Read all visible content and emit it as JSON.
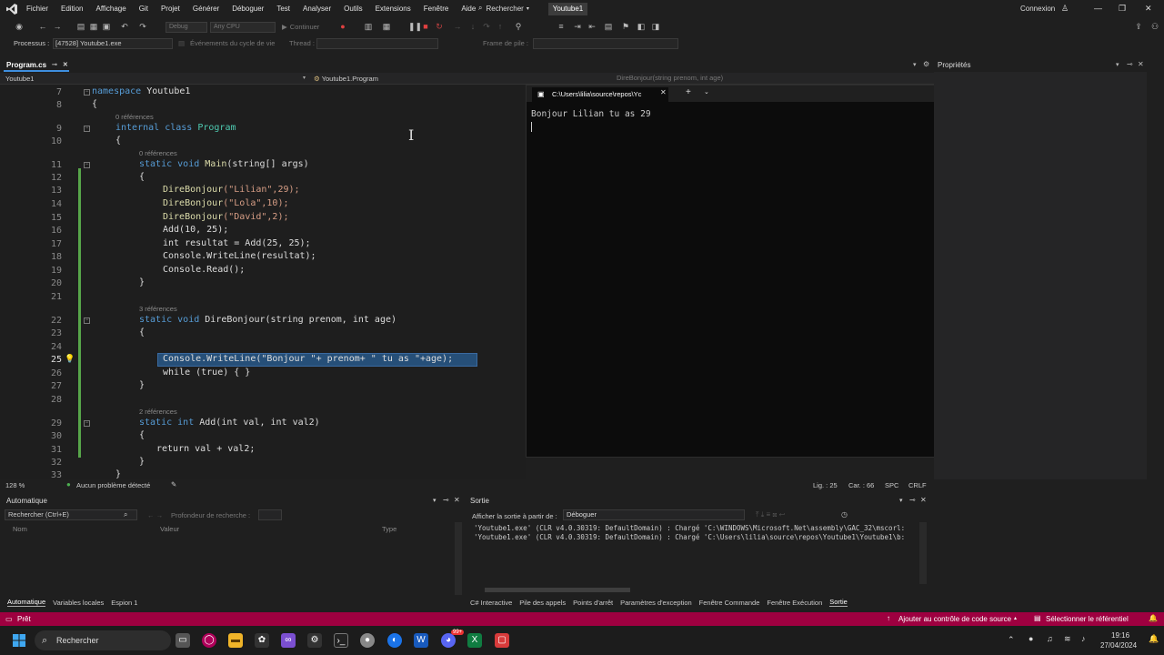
{
  "menubar": {
    "items": [
      "Fichier",
      "Edition",
      "Affichage",
      "Git",
      "Projet",
      "Générer",
      "Déboguer",
      "Test",
      "Analyser",
      "Outils",
      "Extensions",
      "Fenêtre",
      "Aide"
    ],
    "search_label": "Rechercher",
    "solution_name": "Youtube1",
    "connexion_label": "Connexion"
  },
  "toolbar": {
    "config_combo": "Debug",
    "platform_combo": "Any CPU",
    "continue_label": "Continuer"
  },
  "process_bar": {
    "process_label": "Processus :",
    "process_value": "[47528] Youtube1.exe",
    "lifecycle_label": "Événements du cycle de vie",
    "thread_label": "Thread :",
    "frame_label": "Frame de pile :"
  },
  "editor": {
    "tab_label": "Program.cs",
    "nav_project": "Youtube1",
    "nav_class": "Youtube1.Program",
    "nav_member": "DireBonjour(string prenom, int age)",
    "refs": {
      "r0a": "0 références",
      "r0b": "0 références",
      "r3": "3 références",
      "r2": "2 références"
    },
    "line_numbers": {
      "l7": "7",
      "l8": "8",
      "l9": "9",
      "l10": "10",
      "l11": "11",
      "l12": "12",
      "l13": "13",
      "l14": "14",
      "l15": "15",
      "l16": "16",
      "l17": "17",
      "l18": "18",
      "l19": "19",
      "l20": "20",
      "l21": "21",
      "l22": "22",
      "l23": "23",
      "l24": "24",
      "l25": "25",
      "l26": "26",
      "l27": "27",
      "l28": "28",
      "l29": "29",
      "l30": "30",
      "l31": "31",
      "l32": "32",
      "l33": "33"
    },
    "code": {
      "namespace_kw": "namespace",
      "namespace_name": "Youtube1",
      "open_brace": "{",
      "close_brace": "}",
      "internal_kw": "internal",
      "class_kw": "class",
      "class_name": "Program",
      "static_kw": "static",
      "void_kw": "void",
      "int_kw": "int",
      "string_kw": "string",
      "main_name": "Main",
      "main_params": "(string[] args)",
      "call1_fn": "DireBonjour",
      "call1_args": "(\"Lilian\",29);",
      "call2_fn": "DireBonjour",
      "call2_args": "(\"Lola\",10);",
      "call3_fn": "DireBonjour",
      "call3_args": "(\"David\",2);",
      "add_call": "Add(10, 25);",
      "resultat_line": "int resultat = Add(25, 25);",
      "writeline_line": "Console.WriteLine(resultat);",
      "read_line": "Console.Read();",
      "direbonjour_sig": "DireBonjour(string prenom, int age)",
      "selected_line": "Console.WriteLine(\"Bonjour \"+ prenom+ \" tu as \"+age);",
      "while_line": "while (true) { }",
      "add_sig": "Add(int val, int val2)",
      "return_line": "return val + val2;"
    },
    "zoom": "128 %",
    "problems": "Aucun problème détecté",
    "position": "Lig. : 25",
    "column": "Car. : 66",
    "spc": "SPC",
    "crlf": "CRLF"
  },
  "console": {
    "tab_title": "C:\\Users\\lilia\\source\\repos\\Yc",
    "output": "Bonjour Lilian tu as 29"
  },
  "properties": {
    "title": "Propriétés"
  },
  "auto_panel": {
    "title": "Automatique",
    "search_placeholder": "Rechercher (Ctrl+E)",
    "depth_label": "Profondeur de recherche :",
    "col_name": "Nom",
    "col_value": "Valeur",
    "col_type": "Type",
    "tabs": [
      "Automatique",
      "Variables locales",
      "Espion 1"
    ]
  },
  "output_panel": {
    "title": "Sortie",
    "show_from_label": "Afficher la sortie à partir de :",
    "show_from_value": "Déboguer",
    "line1": "'Youtube1.exe' (CLR v4.0.30319: DefaultDomain) : Chargé 'C:\\WINDOWS\\Microsoft.Net\\assembly\\GAC_32\\mscorl:",
    "line2": "'Youtube1.exe' (CLR v4.0.30319: DefaultDomain) : Chargé 'C:\\Users\\lilia\\source\\repos\\Youtube1\\Youtube1\\b:",
    "tabs": [
      "C# Interactive",
      "Pile des appels",
      "Points d'arrêt",
      "Paramètres d'exception",
      "Fenêtre Commande",
      "Fenêtre Exécution",
      "Sortie"
    ]
  },
  "statusbar": {
    "ready": "Prêt",
    "source_control": "Ajouter au contrôle de code source",
    "repo": "Sélectionner le référentiel"
  },
  "taskbar": {
    "search_label": "Rechercher",
    "time": "19:16",
    "date": "27/04/2024",
    "badge": "99+"
  },
  "colors": {
    "statusbar": "#9e0040",
    "selection": "#264f78",
    "keyword": "#569cd6",
    "type": "#4ec9b0",
    "string": "#d69d85"
  }
}
